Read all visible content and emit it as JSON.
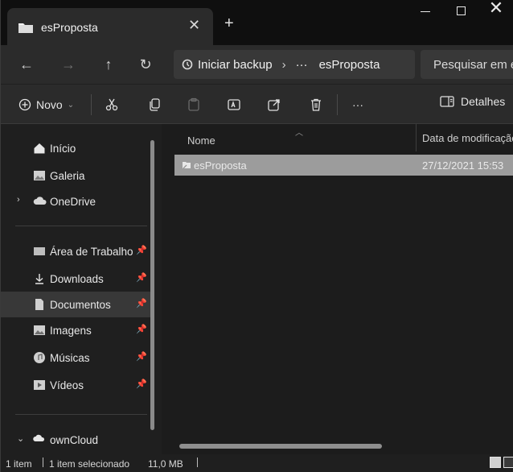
{
  "window": {
    "tab_title": "esProposta",
    "new_tab": "+",
    "tab_close": "✕",
    "controls": {
      "close": "✕"
    }
  },
  "addressbar": {
    "back": "←",
    "forward": "→",
    "up": "↑",
    "refresh": "↻",
    "crumb_root": "Iniciar backup",
    "crumb_sep": "›",
    "crumb_more": "···",
    "crumb_current": "esProposta",
    "search_placeholder": "Pesquisar em es"
  },
  "toolbar": {
    "new_label": "Novo",
    "more": "···",
    "details_label": "Detalhes"
  },
  "sidebar": {
    "items": [
      {
        "label": "Início",
        "icon": "home-icon"
      },
      {
        "label": "Galeria",
        "icon": "gallery-icon"
      },
      {
        "label": "OneDrive",
        "icon": "cloud-icon"
      },
      {
        "label": "Área de Trabalho",
        "icon": "desktop-icon",
        "pinned": true
      },
      {
        "label": "Downloads",
        "icon": "download-icon",
        "pinned": true
      },
      {
        "label": "Documentos",
        "icon": "documents-icon",
        "pinned": true,
        "selected": true
      },
      {
        "label": "Imagens",
        "icon": "pictures-icon",
        "pinned": true
      },
      {
        "label": "Músicas",
        "icon": "music-icon",
        "pinned": true
      },
      {
        "label": "Vídeos",
        "icon": "videos-icon",
        "pinned": true
      },
      {
        "label": "ownCloud",
        "icon": "owncloud-icon"
      }
    ]
  },
  "content": {
    "columns": {
      "name": "Nome",
      "date": "Data de modificação"
    },
    "files": [
      {
        "name": "esProposta",
        "date": "27/12/2021 15:53"
      }
    ]
  },
  "statusbar": {
    "count": "1 item",
    "selected": "1 item selecionado",
    "size": "11,0 MB"
  },
  "colors": {
    "background": "#1f1f1f",
    "titlebar": "#0f0f0f",
    "toolbar": "#2b2b2b",
    "selection": "#9c9c9c"
  }
}
